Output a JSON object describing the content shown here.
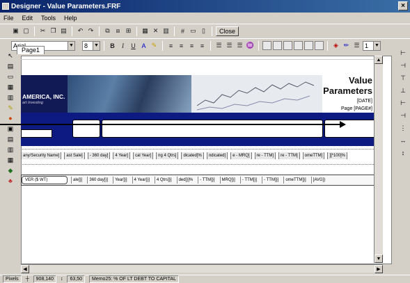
{
  "window": {
    "title": "Designer - Value Parameters.FRF",
    "close": "×"
  },
  "menu": [
    "File",
    "Edit",
    "Tools",
    "Help"
  ],
  "toolbar": {
    "close_label": "Close"
  },
  "format_bar": {
    "font": "Arial",
    "size": "8",
    "line_width": "1",
    "bold": "B",
    "italic": "I",
    "underline": "U"
  },
  "tabs": [
    {
      "label": "Page1"
    }
  ],
  "report": {
    "company": "AMERICA, INC.",
    "tagline": "art Investing",
    "title_line1": "Value",
    "title_line2": "Parameters",
    "date": "[DATE]",
    "page": "Page [PAGE#]"
  },
  "label_cells": [
    "any/Security Name]",
    "ast Sale]",
    "- 360 day]",
    "4 Year]",
    "cal Year]",
    "ng 4 Qtrs]",
    "dicated]%",
    "ndicated]",
    "e - MRQ]",
    "re - TTM]",
    "re - TTM]",
    "omeTTM]",
    "]]*100]%"
  ],
  "data_cells": [
    "VER ($ WT)",
    "ale]}]",
    "360 day]}]",
    "Year]}]",
    "4 Year]}]",
    "4 Qtrs]}]",
    "ded]}]%",
    "- TTM]}]",
    "MRQ]}]",
    "- TTM]}]",
    "- TTM]}]",
    "omeTTM]}]",
    "[AVG]}"
  ],
  "status": {
    "units": "Pixels",
    "position": "908,140",
    "size": "63,50",
    "selection": "Memo25: % OF LT DEBT TO CAPITAL"
  },
  "colors": {
    "navy_band": "#0c1a82",
    "titlebar": "#0a246a"
  }
}
